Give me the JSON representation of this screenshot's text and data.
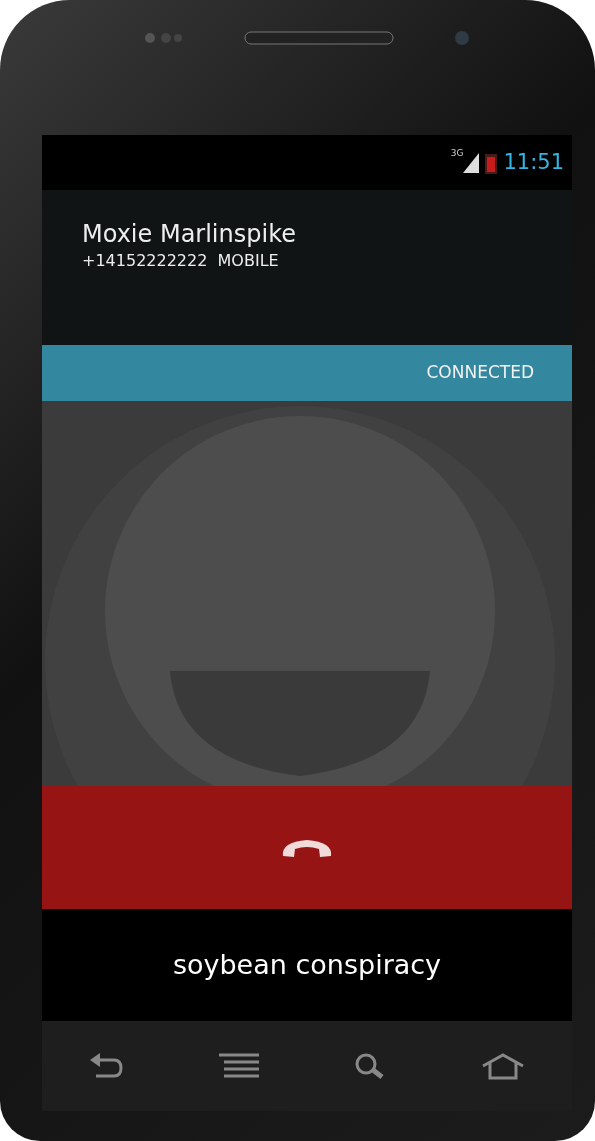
{
  "status_bar": {
    "network": "3G",
    "time": "11:51"
  },
  "contact": {
    "name": "Moxie Marlinspike",
    "number": "+14152222222",
    "label": "MOBILE"
  },
  "call_state": "CONNECTED",
  "end_call_button": {
    "kind": "hangup"
  },
  "sas_phrase": "soybean conspiracy",
  "nav_bar": [
    {
      "kind": "back"
    },
    {
      "kind": "menu"
    },
    {
      "kind": "search"
    },
    {
      "kind": "home"
    }
  ]
}
